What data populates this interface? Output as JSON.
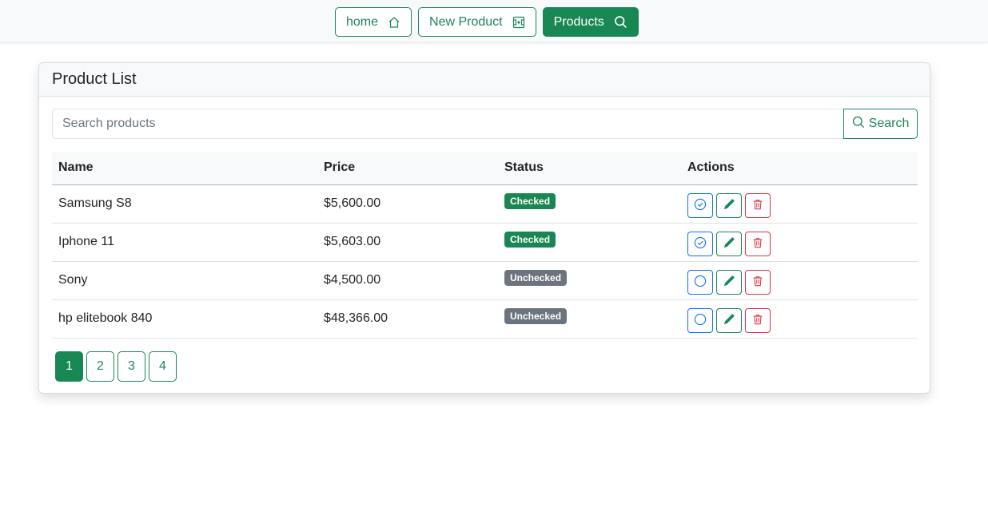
{
  "nav": {
    "home_label": "home",
    "new_product_label": "New Product",
    "products_label": "Products"
  },
  "card": {
    "title": "Product List"
  },
  "search": {
    "placeholder": "Search products",
    "value": "",
    "button_label": "Search"
  },
  "table": {
    "headers": {
      "name": "Name",
      "price": "Price",
      "status": "Status",
      "actions": "Actions"
    },
    "rows": [
      {
        "name": "Samsung S8",
        "price": "$5,600.00",
        "status": "Checked"
      },
      {
        "name": "Iphone 11",
        "price": "$5,603.00",
        "status": "Checked"
      },
      {
        "name": "Sony",
        "price": "$4,500.00",
        "status": "Unchecked"
      },
      {
        "name": "hp elitebook 840",
        "price": "$48,366.00",
        "status": "Unchecked"
      }
    ]
  },
  "pagination": {
    "pages": [
      "1",
      "2",
      "3",
      "4"
    ],
    "current": "1"
  },
  "colors": {
    "success": "#198754",
    "primary": "#0d6efd",
    "danger": "#dc3545",
    "secondary": "#6c757d"
  },
  "icons": {
    "home": "house-icon",
    "new_product": "add-box-icon",
    "products": "search-icon",
    "search": "search-icon",
    "check": "check-circle-icon",
    "uncheck": "circle-icon",
    "edit": "pencil-icon",
    "delete": "trash-icon"
  }
}
